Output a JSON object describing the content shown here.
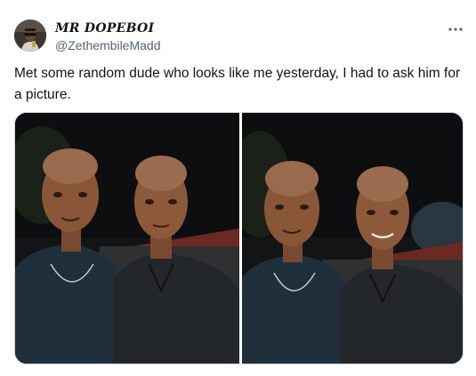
{
  "tweet": {
    "author": {
      "display_name": "MR DOPEBOI",
      "handle": "@ZethembileMadd",
      "avatar_icon": "profile-avatar"
    },
    "menu_icon": "more-horizontal-icon",
    "text": "Met some random dude who looks like me yesterday, I had to ask him for a picture.",
    "media": {
      "photo_count": 2
    }
  },
  "colors": {
    "text_primary": "#0f1419",
    "text_secondary": "#536471",
    "media_border": "#cfd9de"
  }
}
